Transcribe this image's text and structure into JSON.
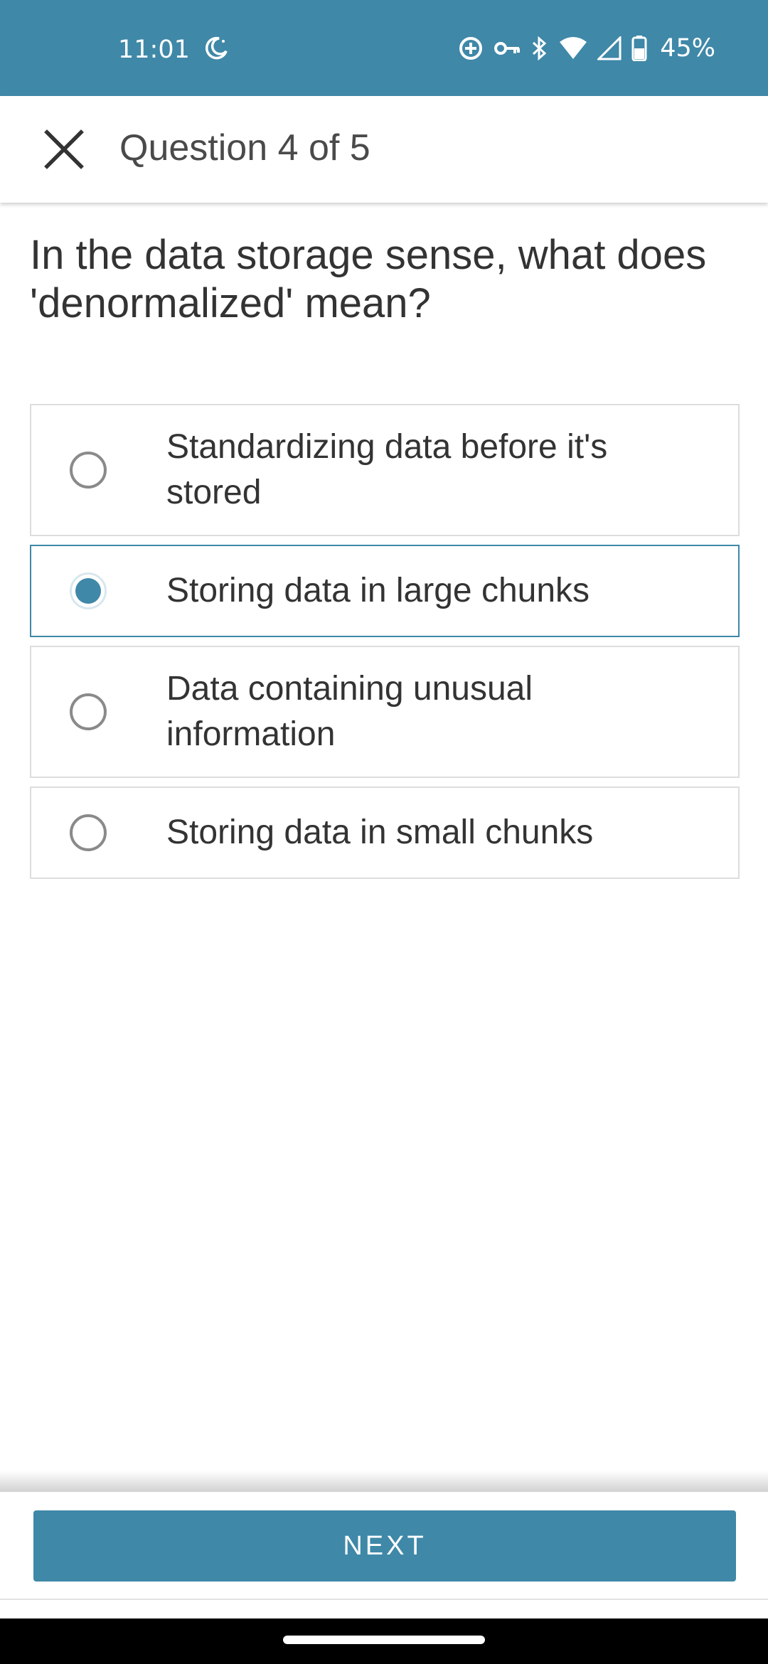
{
  "status_bar": {
    "time": "11:01",
    "battery": "45%",
    "icons": [
      "moon-icon",
      "data-saver-icon",
      "vpn-key-icon",
      "bluetooth-icon",
      "wifi-icon",
      "signal-icon",
      "battery-icon"
    ]
  },
  "app_bar": {
    "title": "Question 4 of 5",
    "close_icon": "close-icon"
  },
  "question": {
    "text": "In the data storage sense, what does 'denormalized' mean?"
  },
  "options": [
    {
      "label": "Standardizing data before it's stored",
      "selected": false
    },
    {
      "label": "Storing data in large chunks",
      "selected": true
    },
    {
      "label": "Data containing unusual information",
      "selected": false
    },
    {
      "label": "Storing data in small chunks",
      "selected": false
    }
  ],
  "footer": {
    "next_label": "NEXT"
  },
  "colors": {
    "accent": "#3f88a8",
    "border": "#dddddd"
  }
}
